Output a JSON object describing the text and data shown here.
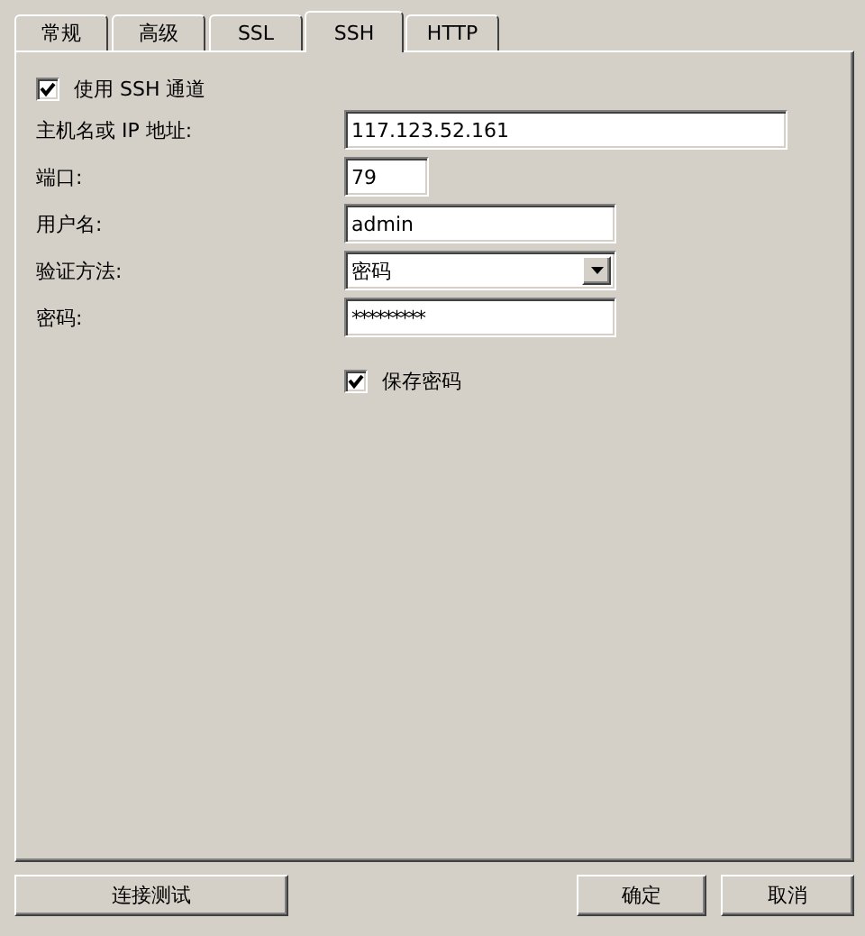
{
  "tabs": [
    {
      "label": "常规",
      "selected": false
    },
    {
      "label": "高级",
      "selected": false
    },
    {
      "label": "SSL",
      "selected": false
    },
    {
      "label": "SSH",
      "selected": true
    },
    {
      "label": "HTTP",
      "selected": false
    }
  ],
  "use_ssh": {
    "label": "使用 SSH 通道",
    "checked": true
  },
  "fields": [
    {
      "kind": "text",
      "label": "主机名或 IP 地址:",
      "value": "117.123.52.161"
    },
    {
      "kind": "text",
      "label": "端口:",
      "value": "79"
    },
    {
      "kind": "text",
      "label": "用户名:",
      "value": "admin"
    },
    {
      "kind": "dropdown",
      "label": "验证方法:",
      "value": "密码"
    },
    {
      "kind": "password",
      "label": "密码:",
      "value": "*********"
    }
  ],
  "save_password": {
    "label": "保存密码",
    "checked": true
  },
  "buttons": [
    {
      "kind": "test",
      "label": "连接测试"
    },
    {
      "kind": "ok",
      "label": "确定"
    },
    {
      "kind": "cancel",
      "label": "取消"
    }
  ]
}
